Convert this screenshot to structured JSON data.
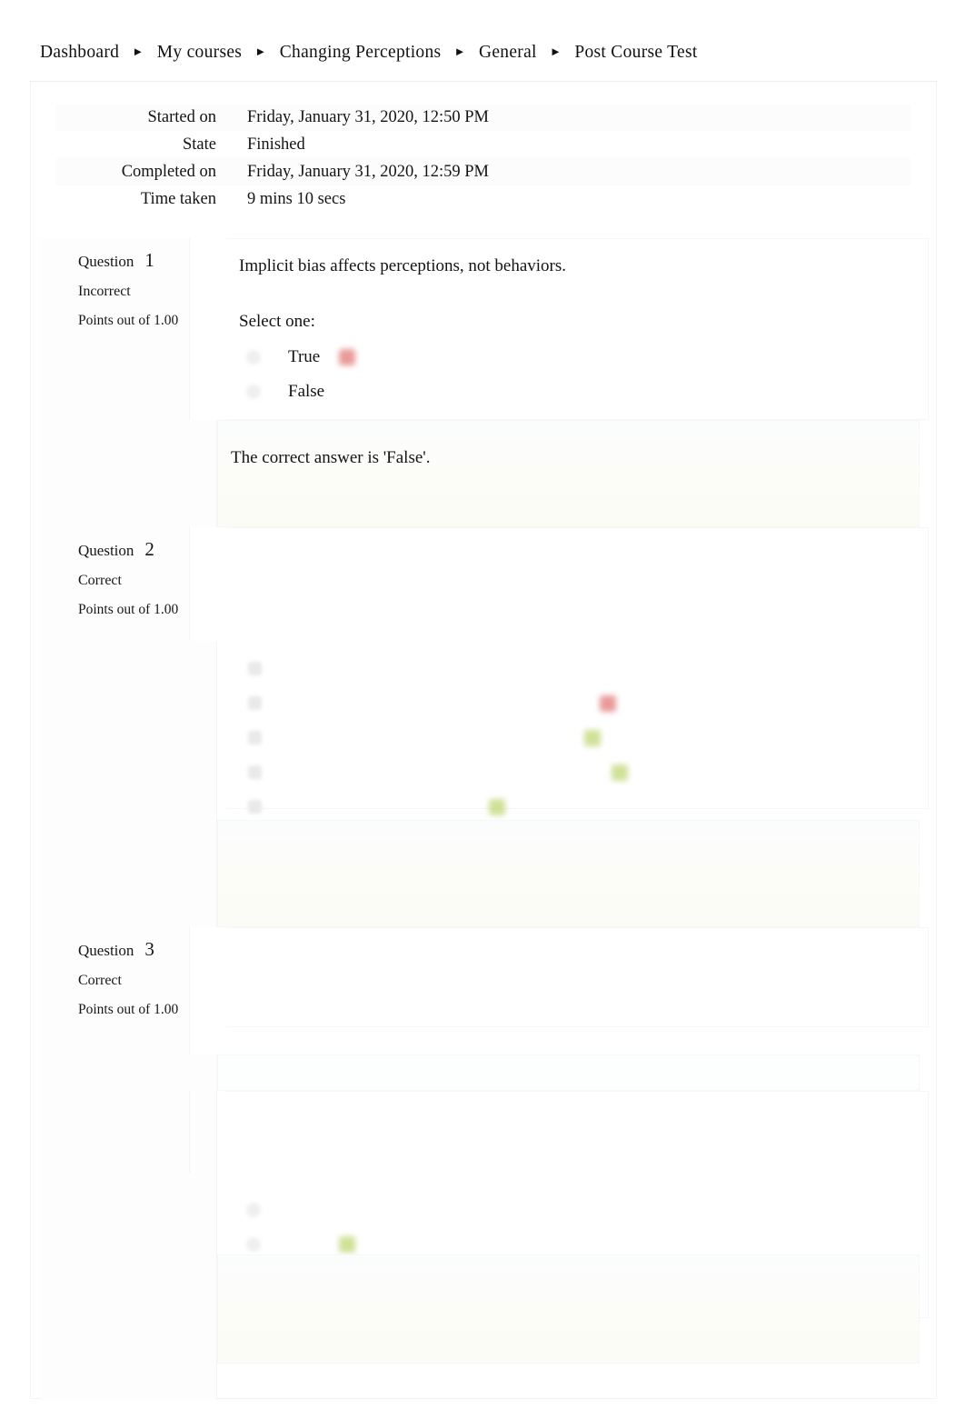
{
  "breadcrumb": {
    "separator": "►",
    "items": [
      {
        "label": "Dashboard"
      },
      {
        "label": "My  courses"
      },
      {
        "label": "Changing  Perceptions"
      },
      {
        "label": "General"
      },
      {
        "label": "Post  Course  Test"
      }
    ]
  },
  "quiz_info": {
    "rows": [
      {
        "label": "Started on",
        "value": "Friday, January 31, 2020, 12:50 PM"
      },
      {
        "label": "State",
        "value": "Finished"
      },
      {
        "label": "Completed on",
        "value": "Friday, January 31, 2020, 12:59 PM"
      },
      {
        "label": "Time taken",
        "value": "9 mins 10 secs"
      }
    ]
  },
  "questions": [
    {
      "number_label": "Question",
      "number": "1",
      "state": "Incorrect",
      "grade": "Points out of 1.00",
      "text": "Implicit bias affects perceptions, not behaviors.",
      "select_label": "Select one:",
      "options": [
        {
          "label": "True",
          "marker": "wrong"
        },
        {
          "label": "False",
          "marker": "none"
        }
      ],
      "feedback": "The correct answer is 'False'."
    },
    {
      "number_label": "Question",
      "number": "2",
      "state": "Correct",
      "grade": "Points out of 1.00",
      "text": "",
      "select_label": "",
      "options": [
        {
          "label": "",
          "marker": "none"
        },
        {
          "label": "",
          "marker": "wrong"
        },
        {
          "label": "",
          "marker": "right"
        },
        {
          "label": "",
          "marker": "right"
        },
        {
          "label": "",
          "marker": "right"
        }
      ],
      "feedback": ""
    },
    {
      "number_label": "Question",
      "number": "3",
      "state": "Correct",
      "grade": "Points out of 1.00",
      "text": "",
      "select_label": "",
      "options": [
        {
          "label": "",
          "marker": "none"
        },
        {
          "label": "",
          "marker": "right"
        }
      ],
      "feedback": ""
    }
  ],
  "colors": {
    "page_background": "#ffffff",
    "container_background": "#ffffff",
    "text": "#131313",
    "incorrect_marker": "#d9534f",
    "correct_marker": "#a4c639",
    "feedback_background": "#fcfcf6"
  }
}
